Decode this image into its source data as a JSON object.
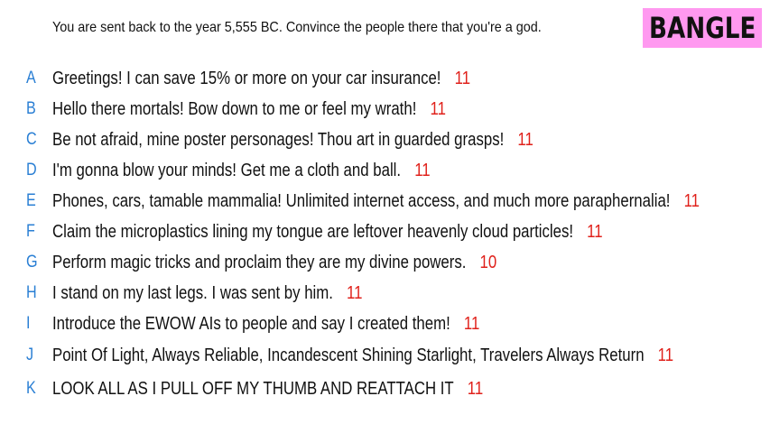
{
  "prompt": "You are sent back to the year 5,555 BC. Convince the people there that you're a god.",
  "badge": {
    "label": "BANGLE",
    "color": "#ff99f0"
  },
  "colors": {
    "letter": "#2a7fd4",
    "score": "#e0211b",
    "text": "#111111"
  },
  "responses": [
    {
      "letter": "A",
      "text": "Greetings! I can save 15% or more on your car insurance!",
      "score": "11"
    },
    {
      "letter": "B",
      "text": "Hello there mortals! Bow down to me or feel my wrath!",
      "score": "11"
    },
    {
      "letter": "C",
      "text": "Be not afraid, mine poster personages! Thou art in guarded grasps!",
      "score": "11"
    },
    {
      "letter": "D",
      "text": "I'm gonna blow your minds! Get me a cloth and ball.",
      "score": "11"
    },
    {
      "letter": "E",
      "text": "Phones, cars, tamable mammalia! Unlimited internet access, and much more paraphernalia!",
      "score": "11"
    },
    {
      "letter": "F",
      "text": "Claim the microplastics lining my tongue are leftover heavenly cloud particles!",
      "score": "11"
    },
    {
      "letter": "G",
      "text": "Perform magic tricks and proclaim they are my divine powers.",
      "score": "10"
    },
    {
      "letter": "H",
      "text": "I stand on my last legs. I was sent by him.",
      "score": "11"
    },
    {
      "letter": "I",
      "text": "Introduce the EWOW AIs to people and say I created them!",
      "score": "11"
    },
    {
      "letter": "J",
      "text": "Point Of Light, Always Reliable, Incandescent Shining Starlight, Travelers Always Return",
      "score": "11"
    },
    {
      "letter": "K",
      "text": "LOOK ALL AS I PULL OFF MY THUMB AND REATTACH IT",
      "score": "11"
    }
  ]
}
